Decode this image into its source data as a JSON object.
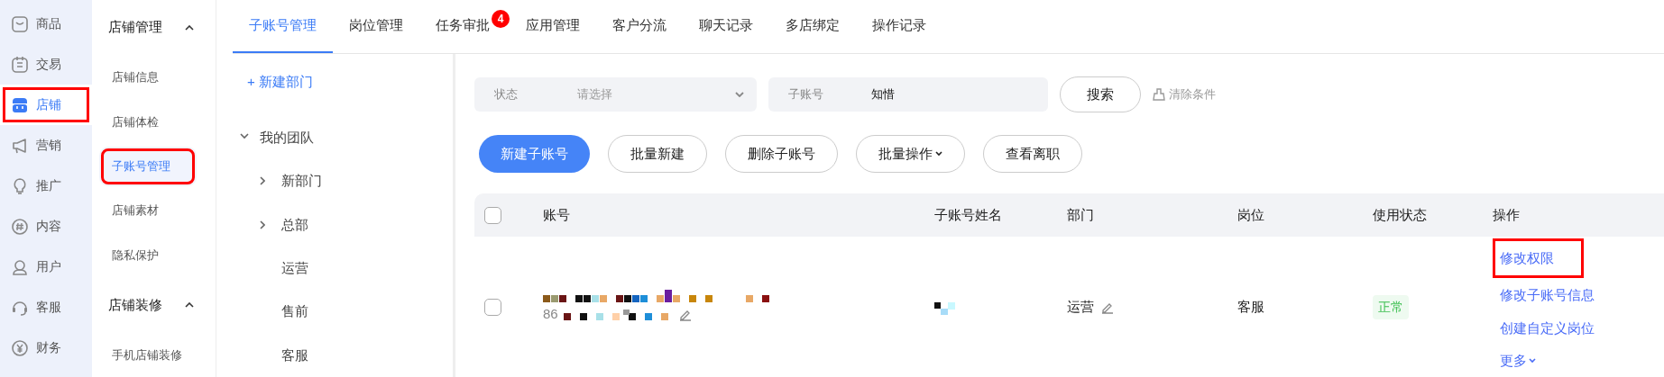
{
  "nav": [
    {
      "label": "商品",
      "selected": false,
      "highlighted": false
    },
    {
      "label": "交易",
      "selected": false,
      "highlighted": false
    },
    {
      "label": "店铺",
      "selected": true,
      "highlighted": true
    },
    {
      "label": "营销",
      "selected": false,
      "highlighted": false
    },
    {
      "label": "推广",
      "selected": false,
      "highlighted": false
    },
    {
      "label": "内容",
      "selected": false,
      "highlighted": false
    },
    {
      "label": "用户",
      "selected": false,
      "highlighted": false
    },
    {
      "label": "客服",
      "selected": false,
      "highlighted": false
    },
    {
      "label": "财务",
      "selected": false,
      "highlighted": false
    }
  ],
  "submenu": [
    {
      "title": "店铺管理",
      "expanded": true,
      "items": [
        {
          "label": "店铺信息",
          "selected": false,
          "highlighted": false
        },
        {
          "label": "店铺体检",
          "selected": false,
          "highlighted": false
        },
        {
          "label": "子账号管理",
          "selected": true,
          "highlighted": true
        },
        {
          "label": "店铺素材",
          "selected": false,
          "highlighted": false
        },
        {
          "label": "隐私保护",
          "selected": false,
          "highlighted": false
        }
      ]
    },
    {
      "title": "店铺装修",
      "expanded": true,
      "items": [
        {
          "label": "手机店铺装修",
          "selected": false,
          "highlighted": false
        }
      ]
    }
  ],
  "tabs": [
    {
      "label": "子账号管理",
      "selected": true
    },
    {
      "label": "岗位管理",
      "selected": false
    },
    {
      "label": "任务审批",
      "selected": false,
      "badge": "4"
    },
    {
      "label": "应用管理",
      "selected": false
    },
    {
      "label": "客户分流",
      "selected": false
    },
    {
      "label": "聊天记录",
      "selected": false
    },
    {
      "label": "多店绑定",
      "selected": false
    },
    {
      "label": "操作记录",
      "selected": false
    }
  ],
  "tree": {
    "add_label": "+ 新建部门",
    "root": {
      "label": "我的团队",
      "expanded": true,
      "children": [
        {
          "label": "新部门",
          "expandable": true
        },
        {
          "label": "总部",
          "expandable": true
        },
        {
          "label": "运营",
          "expandable": false
        },
        {
          "label": "售前",
          "expandable": false
        },
        {
          "label": "客服",
          "expandable": false
        }
      ]
    }
  },
  "filters": [
    {
      "kind": "select",
      "label": "状态",
      "placeholder": "请选择"
    },
    {
      "kind": "text",
      "label": "子账号",
      "value": "知惜"
    }
  ],
  "search_button": "搜索",
  "clear_link": "清除条件",
  "actions": [
    {
      "label": "新建子账号",
      "primary": true,
      "dropdown": false
    },
    {
      "label": "批量新建",
      "primary": false,
      "dropdown": false
    },
    {
      "label": "删除子账号",
      "primary": false,
      "dropdown": false
    },
    {
      "label": "批量操作",
      "primary": false,
      "dropdown": true
    },
    {
      "label": "查看离职",
      "primary": false,
      "dropdown": false
    }
  ],
  "table": {
    "header_checked": false,
    "columns": [
      "账号",
      "子账号姓名",
      "部门",
      "岗位",
      "使用状态",
      "操作"
    ],
    "rows": [
      {
        "checked": false,
        "account_prefix": "86",
        "department": "运营",
        "position": "客服",
        "status": "正常",
        "operations": [
          {
            "label": "修改权限",
            "highlighted": true,
            "dropdown": false
          },
          {
            "label": "修改子账号信息",
            "highlighted": false,
            "dropdown": false
          },
          {
            "label": "创建自定义岗位",
            "highlighted": false,
            "dropdown": false
          },
          {
            "label": "更多",
            "highlighted": false,
            "dropdown": true
          }
        ]
      }
    ]
  }
}
